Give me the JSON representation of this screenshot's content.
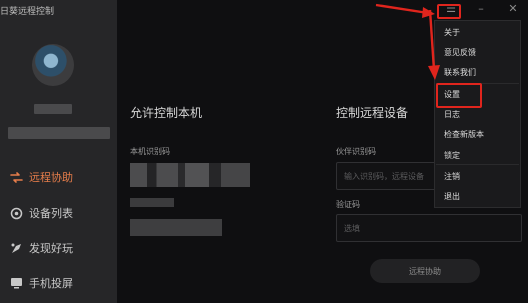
{
  "app": {
    "title": "日葵远程控制"
  },
  "window_controls": {
    "menu": "☰",
    "minimize": "–",
    "close": "✕"
  },
  "sidebar": {
    "items": [
      {
        "label": "远程协助",
        "icon": "remote-assist-icon",
        "active": true
      },
      {
        "label": "设备列表",
        "icon": "device-list-icon",
        "active": false
      },
      {
        "label": "发现好玩",
        "icon": "discover-icon",
        "active": false
      },
      {
        "label": "手机投屏",
        "icon": "screen-cast-icon",
        "active": false
      }
    ]
  },
  "local": {
    "title": "允许控制本机",
    "id_label": "本机识别码"
  },
  "remote": {
    "title": "控制远程设备",
    "partner_label": "伙伴识别码",
    "partner_placeholder": "输入识别码，远程设备",
    "code_label": "验证码",
    "code_placeholder": "选填",
    "connect_button": "远程协助"
  },
  "menu": {
    "items": [
      "关于",
      "意见反馈",
      "联系我们",
      "设置",
      "日志",
      "检查新版本",
      "锁定",
      "注销",
      "退出"
    ],
    "highlighted": "设置"
  },
  "colors": {
    "accent": "#e67d4a",
    "annotation": "#e0251d"
  }
}
